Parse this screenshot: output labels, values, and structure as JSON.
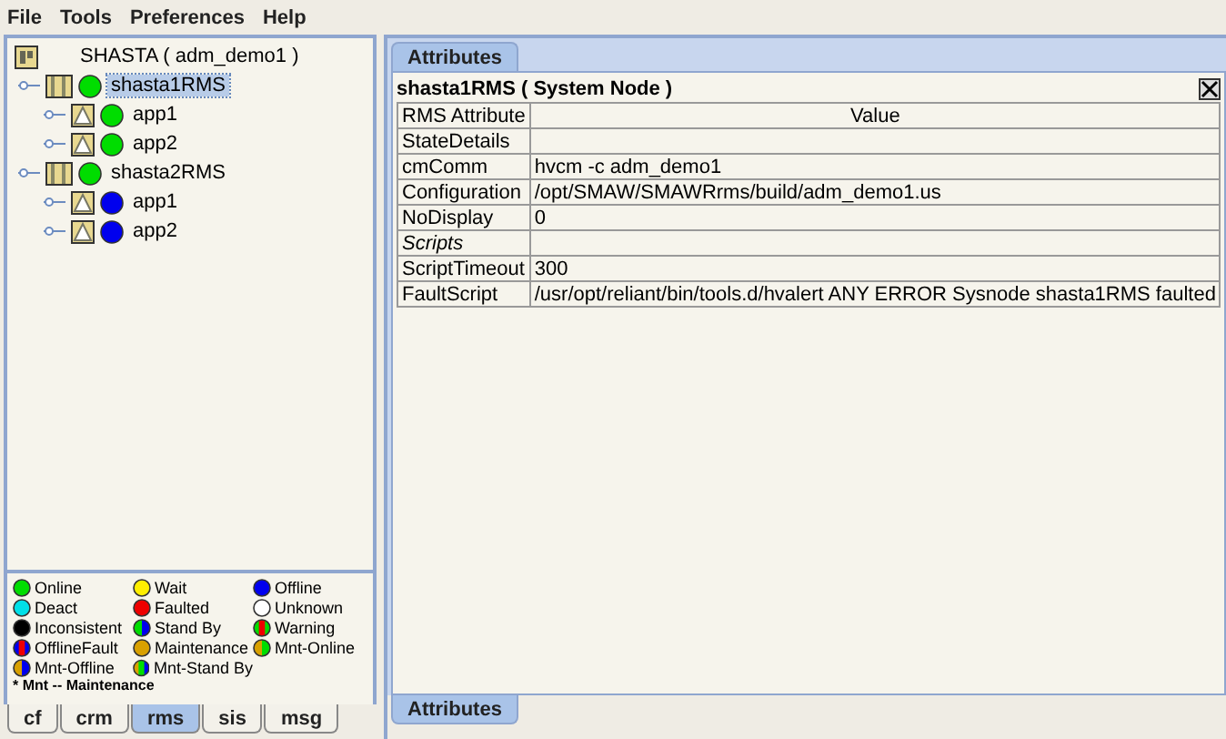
{
  "menu": [
    "File",
    "Tools",
    "Preferences",
    "Help"
  ],
  "tree": {
    "label": "SHASTA ( adm_demo1 )",
    "kind": "cluster",
    "children": [
      {
        "label": "shasta1RMS",
        "kind": "node",
        "color": "#00dd00",
        "selected": true,
        "children": [
          {
            "label": "app1",
            "kind": "app",
            "color": "#00dd00",
            "selected": false
          },
          {
            "label": "app2",
            "kind": "app",
            "color": "#00dd00",
            "selected": false
          }
        ]
      },
      {
        "label": "shasta2RMS",
        "kind": "node",
        "color": "#00dd00",
        "selected": false,
        "children": [
          {
            "label": "app1",
            "kind": "app",
            "color": "#0000ee",
            "selected": false
          },
          {
            "label": "app2",
            "kind": "app",
            "color": "#0000ee",
            "selected": false
          }
        ]
      }
    ]
  },
  "legend": [
    {
      "label": "Online",
      "segments": [
        {
          "color": "#00dd00"
        }
      ]
    },
    {
      "label": "Wait",
      "segments": [
        {
          "color": "#ffee00"
        }
      ]
    },
    {
      "label": "Offline",
      "segments": [
        {
          "color": "#0000ee"
        }
      ]
    },
    {
      "label": "Deact",
      "segments": [
        {
          "color": "#00e0e8"
        }
      ]
    },
    {
      "label": "Faulted",
      "segments": [
        {
          "color": "#ee0000"
        }
      ]
    },
    {
      "label": "Unknown",
      "segments": [
        {
          "color": "#ffffff"
        }
      ]
    },
    {
      "label": "Inconsistent",
      "segments": [
        {
          "color": "#000000"
        }
      ]
    },
    {
      "label": "Stand By",
      "segments": [
        {
          "color": "#00dd00"
        },
        {
          "color": "#0000ee"
        }
      ]
    },
    {
      "label": "Warning",
      "segments": [
        {
          "color": "#00dd00"
        },
        {
          "color": "#ee0000"
        },
        {
          "color": "#00dd00"
        }
      ]
    },
    {
      "label": "OfflineFault",
      "segments": [
        {
          "color": "#0000ee"
        },
        {
          "color": "#ee0000"
        },
        {
          "color": "#0000ee"
        }
      ]
    },
    {
      "label": "Maintenance",
      "segments": [
        {
          "color": "#d8a000"
        }
      ]
    },
    {
      "label": "Mnt-Online",
      "segments": [
        {
          "color": "#d8a000"
        },
        {
          "color": "#00dd00"
        }
      ]
    },
    {
      "label": "Mnt-Offline",
      "segments": [
        {
          "color": "#d8a000"
        },
        {
          "color": "#0000ee"
        }
      ]
    },
    {
      "label": "Mnt-Stand By",
      "segments": [
        {
          "color": "#d8a000"
        },
        {
          "color": "#00dd00"
        },
        {
          "color": "#0000ee"
        }
      ]
    }
  ],
  "legend_note": "* Mnt -- Maintenance",
  "bottom_tabs": [
    {
      "label": "cf",
      "selected": false
    },
    {
      "label": "crm",
      "selected": false
    },
    {
      "label": "rms",
      "selected": true
    },
    {
      "label": "sis",
      "selected": false
    },
    {
      "label": "msg",
      "selected": false
    }
  ],
  "top_tabs": [
    {
      "label": "Attributes",
      "selected": true
    }
  ],
  "panel_title": "shasta1RMS ( System Node )",
  "table": {
    "columns": [
      "RMS Attribute",
      "Value"
    ],
    "rows": [
      {
        "cells": [
          "StateDetails",
          ""
        ],
        "italic": false
      },
      {
        "cells": [
          "cmComm",
          "hvcm -c adm_demo1"
        ],
        "italic": false
      },
      {
        "cells": [
          "Configuration",
          "/opt/SMAW/SMAWRrms/build/adm_demo1.us"
        ],
        "italic": false
      },
      {
        "cells": [
          "NoDisplay",
          "0"
        ],
        "italic": false
      },
      {
        "cells": [
          "Scripts",
          ""
        ],
        "italic": true
      },
      {
        "cells": [
          "ScriptTimeout",
          "300"
        ],
        "italic": false
      },
      {
        "cells": [
          "FaultScript",
          "/usr/opt/reliant/bin/tools.d/hvalert ANY ERROR Sysnode shasta1RMS faulted"
        ],
        "italic": false
      }
    ]
  },
  "lower_tabs": [
    {
      "label": "Attributes",
      "selected": true
    }
  ]
}
